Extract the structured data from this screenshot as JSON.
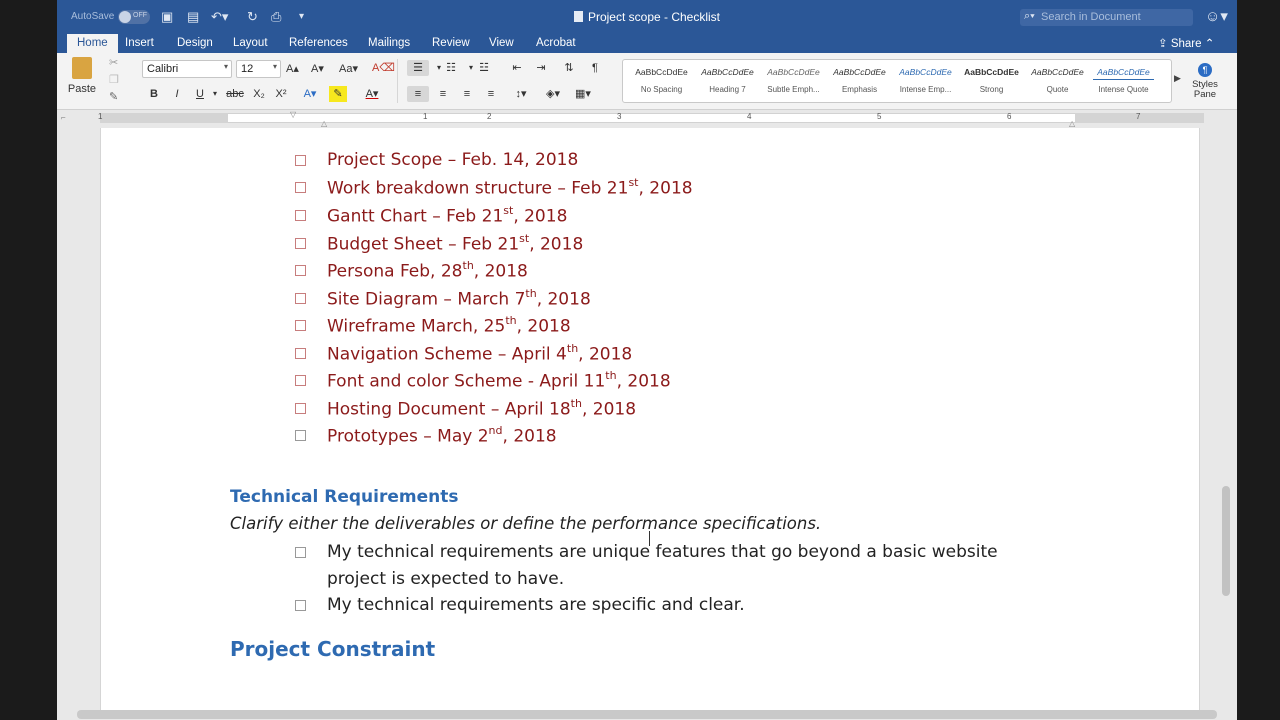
{
  "window": {
    "autosave_label": "AutoSave",
    "autosave_state": "OFF",
    "title": "Project scope - Checklist",
    "search_placeholder": "Search in Document"
  },
  "ribbon_tabs": [
    "Home",
    "Insert",
    "Design",
    "Layout",
    "References",
    "Mailings",
    "Review",
    "View",
    "Acrobat"
  ],
  "active_tab": "Home",
  "share_label": "Share",
  "toolbar": {
    "paste_label": "Paste",
    "font_name": "Calibri",
    "font_size": "12",
    "style_tiles": [
      {
        "sample": "AaBbCcDdEe",
        "name": "No Spacing"
      },
      {
        "sample": "AaBbCcDdEe",
        "name": "Heading 7"
      },
      {
        "sample": "AaBbCcDdEe",
        "name": "Subtle Emph..."
      },
      {
        "sample": "AaBbCcDdEe",
        "name": "Emphasis"
      },
      {
        "sample": "AaBbCcDdEe",
        "name": "Intense Emp..."
      },
      {
        "sample": "AaBbCcDdEe",
        "name": "Strong"
      },
      {
        "sample": "AaBbCcDdEe",
        "name": "Quote"
      },
      {
        "sample": "AaBbCcDdEe",
        "name": "Intense Quote"
      }
    ],
    "styles_pane_label": "Styles Pane"
  },
  "ruler_numbers": [
    "1",
    "1",
    "2",
    "3",
    "4",
    "5",
    "6",
    "7"
  ],
  "document": {
    "deliverables": [
      {
        "text": "Project Scope – Feb. 14, 2018"
      },
      {
        "text": "Work breakdown structure – Feb 21",
        "sup": "st",
        "tail": ", 2018"
      },
      {
        "text": "Gantt Chart – Feb 21",
        "sup": "st",
        "tail": ", 2018"
      },
      {
        "text": "Budget Sheet – Feb 21",
        "sup": "st",
        "tail": ", 2018"
      },
      {
        "text": "Persona Feb, 28",
        "sup": "th",
        "tail": ", 2018"
      },
      {
        "text": "Site Diagram – March 7",
        "sup": "th",
        "tail": ", 2018"
      },
      {
        "text": "Wireframe March, 25",
        "sup": "th",
        "tail": ", 2018"
      },
      {
        "text": "Navigation Scheme – April 4",
        "sup": "th",
        "tail": ", 2018"
      },
      {
        "text": "Font and color Scheme - April 11",
        "sup": "th",
        "tail": ", 2018"
      },
      {
        "text": "Hosting Document – April 18",
        "sup": "th",
        "tail": ", 2018"
      },
      {
        "text": "Prototypes – May 2",
        "sup": "nd",
        "tail": ", 2018"
      }
    ],
    "technical_heading": "Technical Requirements",
    "technical_subtitle": "Clarify either the deliverables or define the performance specifications.",
    "technical_items": [
      {
        "line1": "My technical requirements are unique features that go beyond a basic website",
        "line2": "project is expected to have."
      },
      {
        "line1": "My technical requirements are specific and clear."
      }
    ],
    "constraint_heading": "Project Constraint"
  },
  "colors": {
    "titlebar": "#2b5797",
    "deliverable_text": "#8b1a1a",
    "heading_blue": "#2e6ab1"
  }
}
